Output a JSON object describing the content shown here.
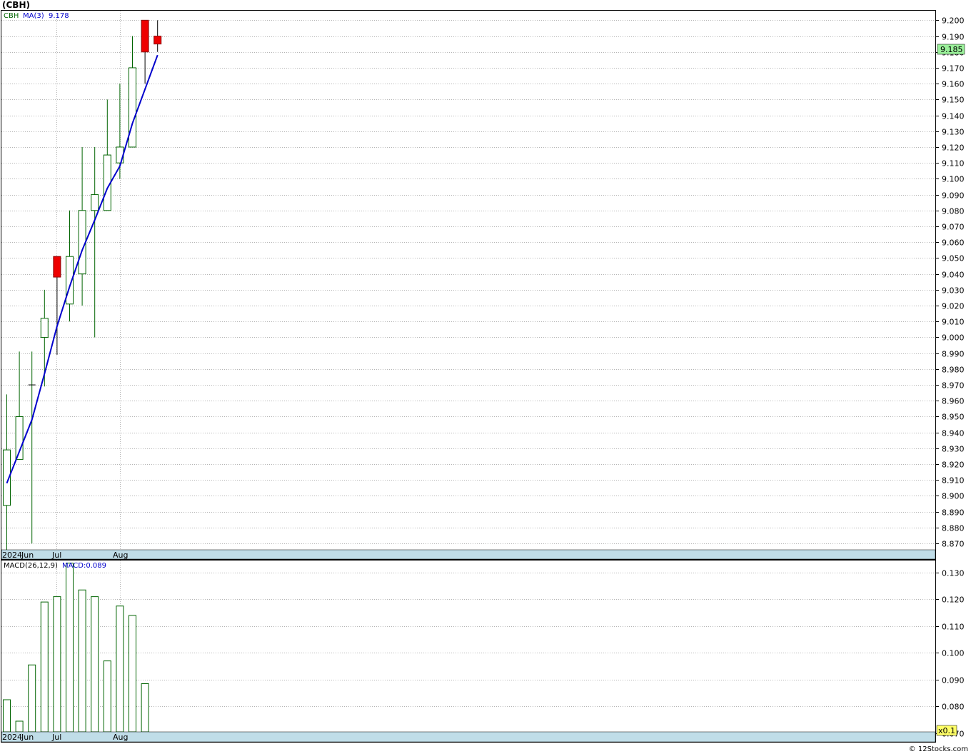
{
  "header": {
    "title": "(CBH)"
  },
  "footer": {
    "copyright": "© 12Stocks.com"
  },
  "colors": {
    "up": "#006400",
    "down": "#ee0000",
    "ma": "#0000cc",
    "axis_strip": "#c0dde8",
    "last_price_box": "#9af09a",
    "macd_box": "#ffff66"
  },
  "chart_data": [
    {
      "type": "candlestick",
      "legend": {
        "symbol": "CBH",
        "ma_label": "MA(3)",
        "ma_value": "9.178"
      },
      "last_price_label": "9.185",
      "ylim": [
        8.866,
        9.206
      ],
      "yticks": [
        "9.200",
        "9.190",
        "9.180",
        "9.170",
        "9.160",
        "9.150",
        "9.140",
        "9.130",
        "9.120",
        "9.110",
        "9.100",
        "9.090",
        "9.080",
        "9.070",
        "9.060",
        "9.050",
        "9.040",
        "9.030",
        "9.020",
        "9.010",
        "9.000",
        "8.990",
        "8.980",
        "8.970",
        "8.960",
        "8.950",
        "8.940",
        "8.930",
        "8.920",
        "8.910",
        "8.900",
        "8.890",
        "8.880",
        "8.870"
      ],
      "xticks": [
        "2024",
        "Jun",
        "Jul",
        "Aug"
      ],
      "candles": [
        {
          "o": 8.894,
          "h": 8.964,
          "l": 8.864,
          "c": 8.929
        },
        {
          "o": 8.923,
          "h": 8.991,
          "l": 8.923,
          "c": 8.95
        },
        {
          "o": 8.97,
          "h": 8.991,
          "l": 8.87,
          "c": 8.97
        },
        {
          "o": 9.0,
          "h": 9.03,
          "l": 8.969,
          "c": 9.012
        },
        {
          "o": 9.051,
          "h": 9.051,
          "l": 8.989,
          "c": 9.038
        },
        {
          "o": 9.021,
          "h": 9.08,
          "l": 9.01,
          "c": 9.051
        },
        {
          "o": 9.04,
          "h": 9.12,
          "l": 9.02,
          "c": 9.08
        },
        {
          "o": 9.08,
          "h": 9.12,
          "l": 9.0,
          "c": 9.09
        },
        {
          "o": 9.08,
          "h": 9.15,
          "l": 9.08,
          "c": 9.115
        },
        {
          "o": 9.11,
          "h": 9.16,
          "l": 9.1,
          "c": 9.12
        },
        {
          "o": 9.12,
          "h": 9.19,
          "l": 9.12,
          "c": 9.17
        },
        {
          "o": 9.2,
          "h": 9.2,
          "l": 9.16,
          "c": 9.18
        },
        {
          "o": 9.19,
          "h": 9.2,
          "l": 9.18,
          "c": 9.185
        }
      ],
      "ma": [
        8.908,
        null,
        8.948,
        8.977,
        9.007,
        9.032,
        9.055,
        9.074,
        9.094,
        9.108,
        9.135,
        null,
        9.178
      ]
    },
    {
      "type": "bar",
      "legend": {
        "label": "MACD(26,12,9)",
        "value_label": "MACD:0.089"
      },
      "axis_box_label": "x0.1",
      "ylim": [
        0.0705,
        0.1345
      ],
      "yticks": [
        "0.130",
        "0.120",
        "0.110",
        "0.100",
        "0.090",
        "0.080",
        "0.070"
      ],
      "xticks": [
        "2024",
        "Jun",
        "Jul",
        "Aug"
      ],
      "values": [
        0.0825,
        0.0745,
        0.0955,
        0.119,
        0.121,
        0.1335,
        0.1235,
        0.121,
        0.097,
        0.1175,
        0.114,
        0.0885
      ]
    }
  ]
}
